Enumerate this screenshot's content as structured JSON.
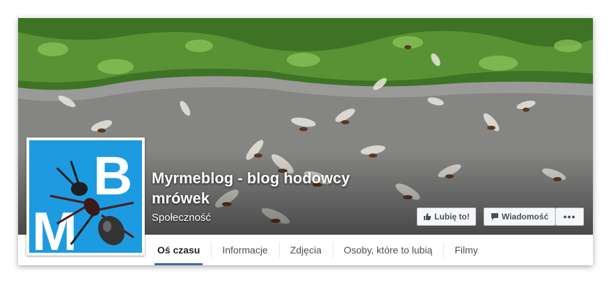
{
  "page": {
    "name": "Myrmeblog - blog hodowcy mrówek",
    "category": "Społeczność",
    "profile_letters": [
      "B",
      "M"
    ]
  },
  "actions": {
    "like_label": "Lubię to!",
    "message_label": "Wiadomość",
    "more_label": "•••"
  },
  "tabs": [
    {
      "label": "Oś czasu",
      "active": true
    },
    {
      "label": "Informacje",
      "active": false
    },
    {
      "label": "Zdjęcia",
      "active": false
    },
    {
      "label": "Osoby, które to lubią",
      "active": false
    },
    {
      "label": "Filmy",
      "active": false
    }
  ],
  "colors": {
    "accent": "#4267b2",
    "profile_bg": "#1c9be0"
  }
}
